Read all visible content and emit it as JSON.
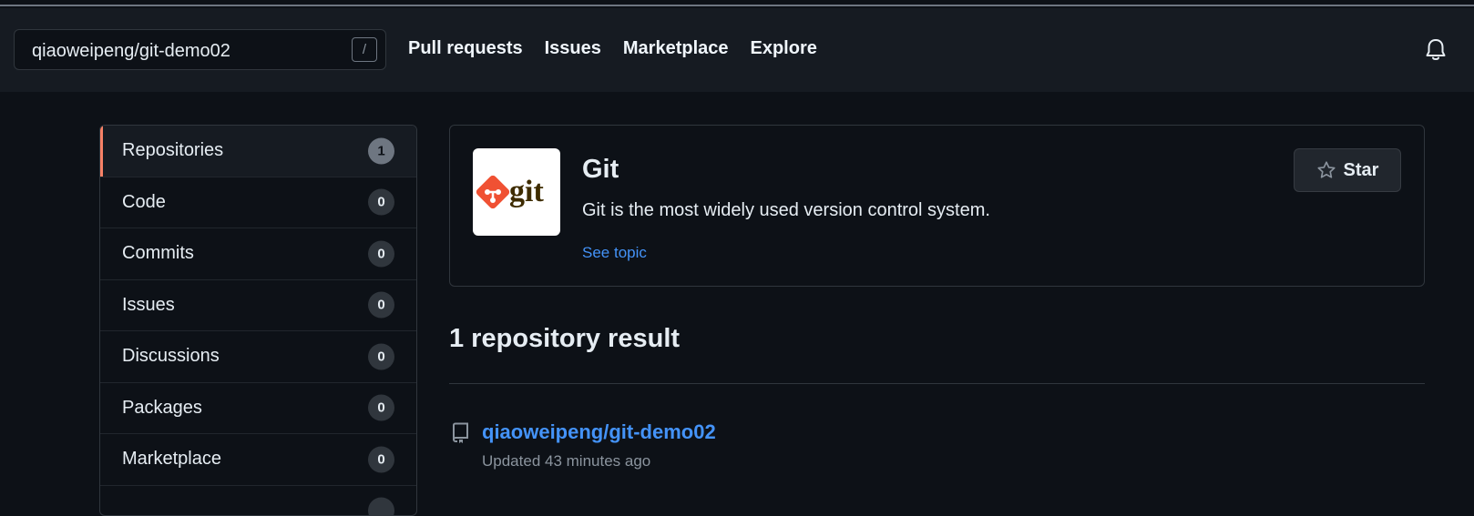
{
  "header": {
    "search_value": "qiaoweipeng/git-demo02",
    "search_shortcut": "/",
    "nav": [
      {
        "label": "Pull requests"
      },
      {
        "label": "Issues"
      },
      {
        "label": "Marketplace"
      },
      {
        "label": "Explore"
      }
    ],
    "notification_icon": "bell-icon"
  },
  "sidebar": {
    "items": [
      {
        "label": "Repositories",
        "count": "1",
        "active": true
      },
      {
        "label": "Code",
        "count": "0"
      },
      {
        "label": "Commits",
        "count": "0"
      },
      {
        "label": "Issues",
        "count": "0"
      },
      {
        "label": "Discussions",
        "count": "0"
      },
      {
        "label": "Packages",
        "count": "0"
      },
      {
        "label": "Marketplace",
        "count": "0"
      }
    ]
  },
  "topic": {
    "logo_text": "git",
    "title": "Git",
    "description": "Git is the most widely used version control system.",
    "link": "See topic",
    "star_label": "Star",
    "star_icon": "star-icon"
  },
  "results": {
    "summary": "1 repository result",
    "items": [
      {
        "name": "qiaoweipeng/git-demo02",
        "updated": "Updated 43 minutes ago",
        "icon": "repo-icon"
      }
    ]
  },
  "colors": {
    "background": "#0d1117",
    "header": "#161b22",
    "link": "#4493f8",
    "active_indicator": "#f78166",
    "git_brand": "#f05133"
  }
}
